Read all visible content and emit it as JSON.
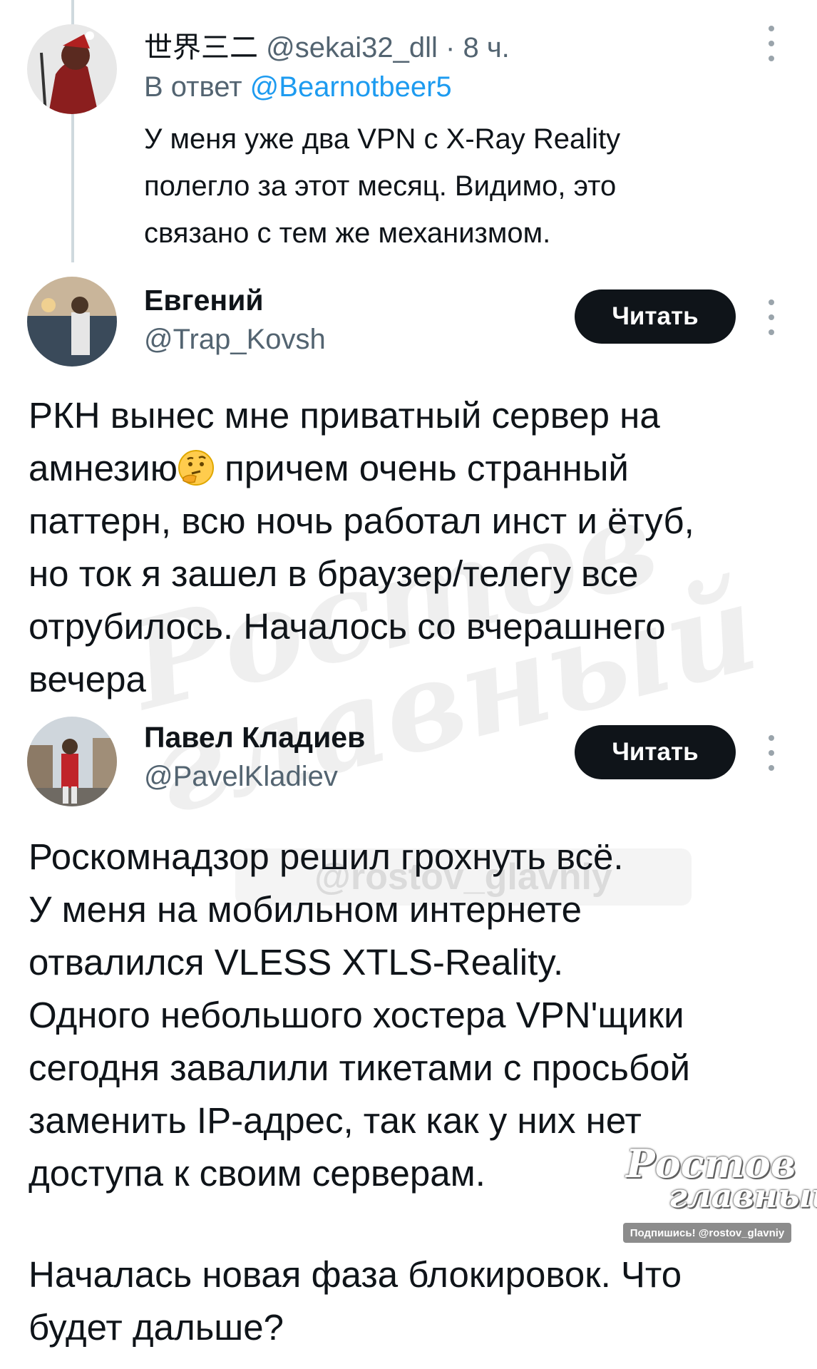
{
  "tweets": [
    {
      "name": "世界三二",
      "handle": "@sekai32_dll",
      "separator": "·",
      "time": "8 ч.",
      "reply_prefix": "В ответ",
      "reply_mention": "@Bearnotbeer5",
      "text_lines": [
        "У меня уже два VPN с X-Ray Reality",
        "полегло за этот месяц. Видимо, это",
        "связано с тем же механизмом."
      ]
    },
    {
      "name": "Евгений",
      "handle": "@Trap_Kovsh",
      "follow_label": "Читать",
      "text_lines": [
        "РКН вынес мне приватный сервер на",
        "амнезию",
        "причем очень странный",
        "паттерн, всю ночь работал инст и ётуб,",
        "но ток я зашел в браузер/телегу все",
        "отрубилось. Началось со вчерашнего",
        "вечера"
      ],
      "emoji": "thinking-face"
    },
    {
      "name": "Павел Кладиев",
      "handle": "@PavelKladiev",
      "follow_label": "Читать",
      "text_lines": [
        "Роскомнадзор решил грохнуть всё.",
        "У меня на мобильном интернете",
        "отвалился VLESS XTLS-Reality.",
        "Одного небольшого хостера VPN'щики",
        "сегодня завалили тикетами с просьбой",
        "заменить IP-адрес, так как у них нет",
        "доступа к своим серверам.",
        "Началась новая фаза блокировок. Что",
        "будет дальше?"
      ]
    }
  ],
  "watermark": {
    "line1": "Ростов",
    "line2": "главный",
    "sub": "@rostov_glavniy",
    "logo_line1": "Ростов",
    "logo_line2": "главный",
    "logo_sub": "Подпишись! @rostov_glavniy"
  },
  "colors": {
    "text": "#0f1419",
    "secondary": "#536471",
    "mention": "#1d9bf0",
    "button_bg": "#0f1419",
    "thread_line": "#cfd9de"
  }
}
